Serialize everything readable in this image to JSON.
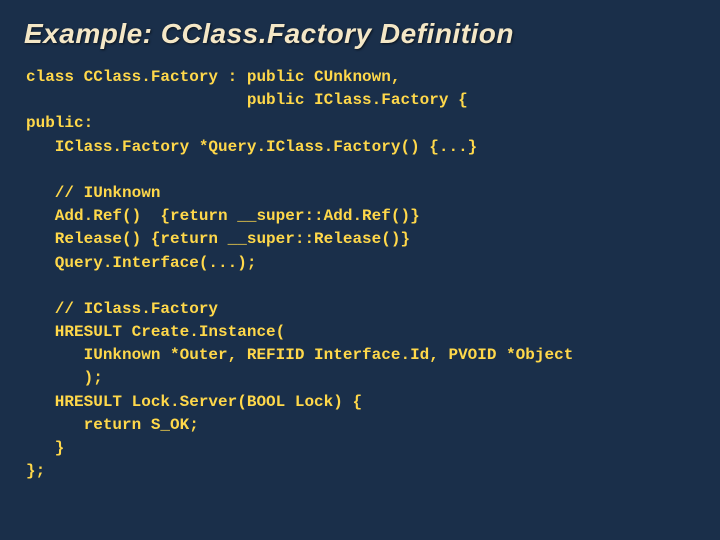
{
  "slide": {
    "title": "Example: CClass.Factory Definition",
    "code": "class CClass.Factory : public CUnknown,\n                       public IClass.Factory {\npublic:\n   IClass.Factory *Query.IClass.Factory() {...}\n\n   // IUnknown\n   Add.Ref()  {return __super::Add.Ref()}\n   Release() {return __super::Release()}\n   Query.Interface(...);\n\n   // IClass.Factory\n   HRESULT Create.Instance(\n      IUnknown *Outer, REFIID Interface.Id, PVOID *Object\n      );\n   HRESULT Lock.Server(BOOL Lock) {\n      return S_OK;\n   }\n};"
  }
}
